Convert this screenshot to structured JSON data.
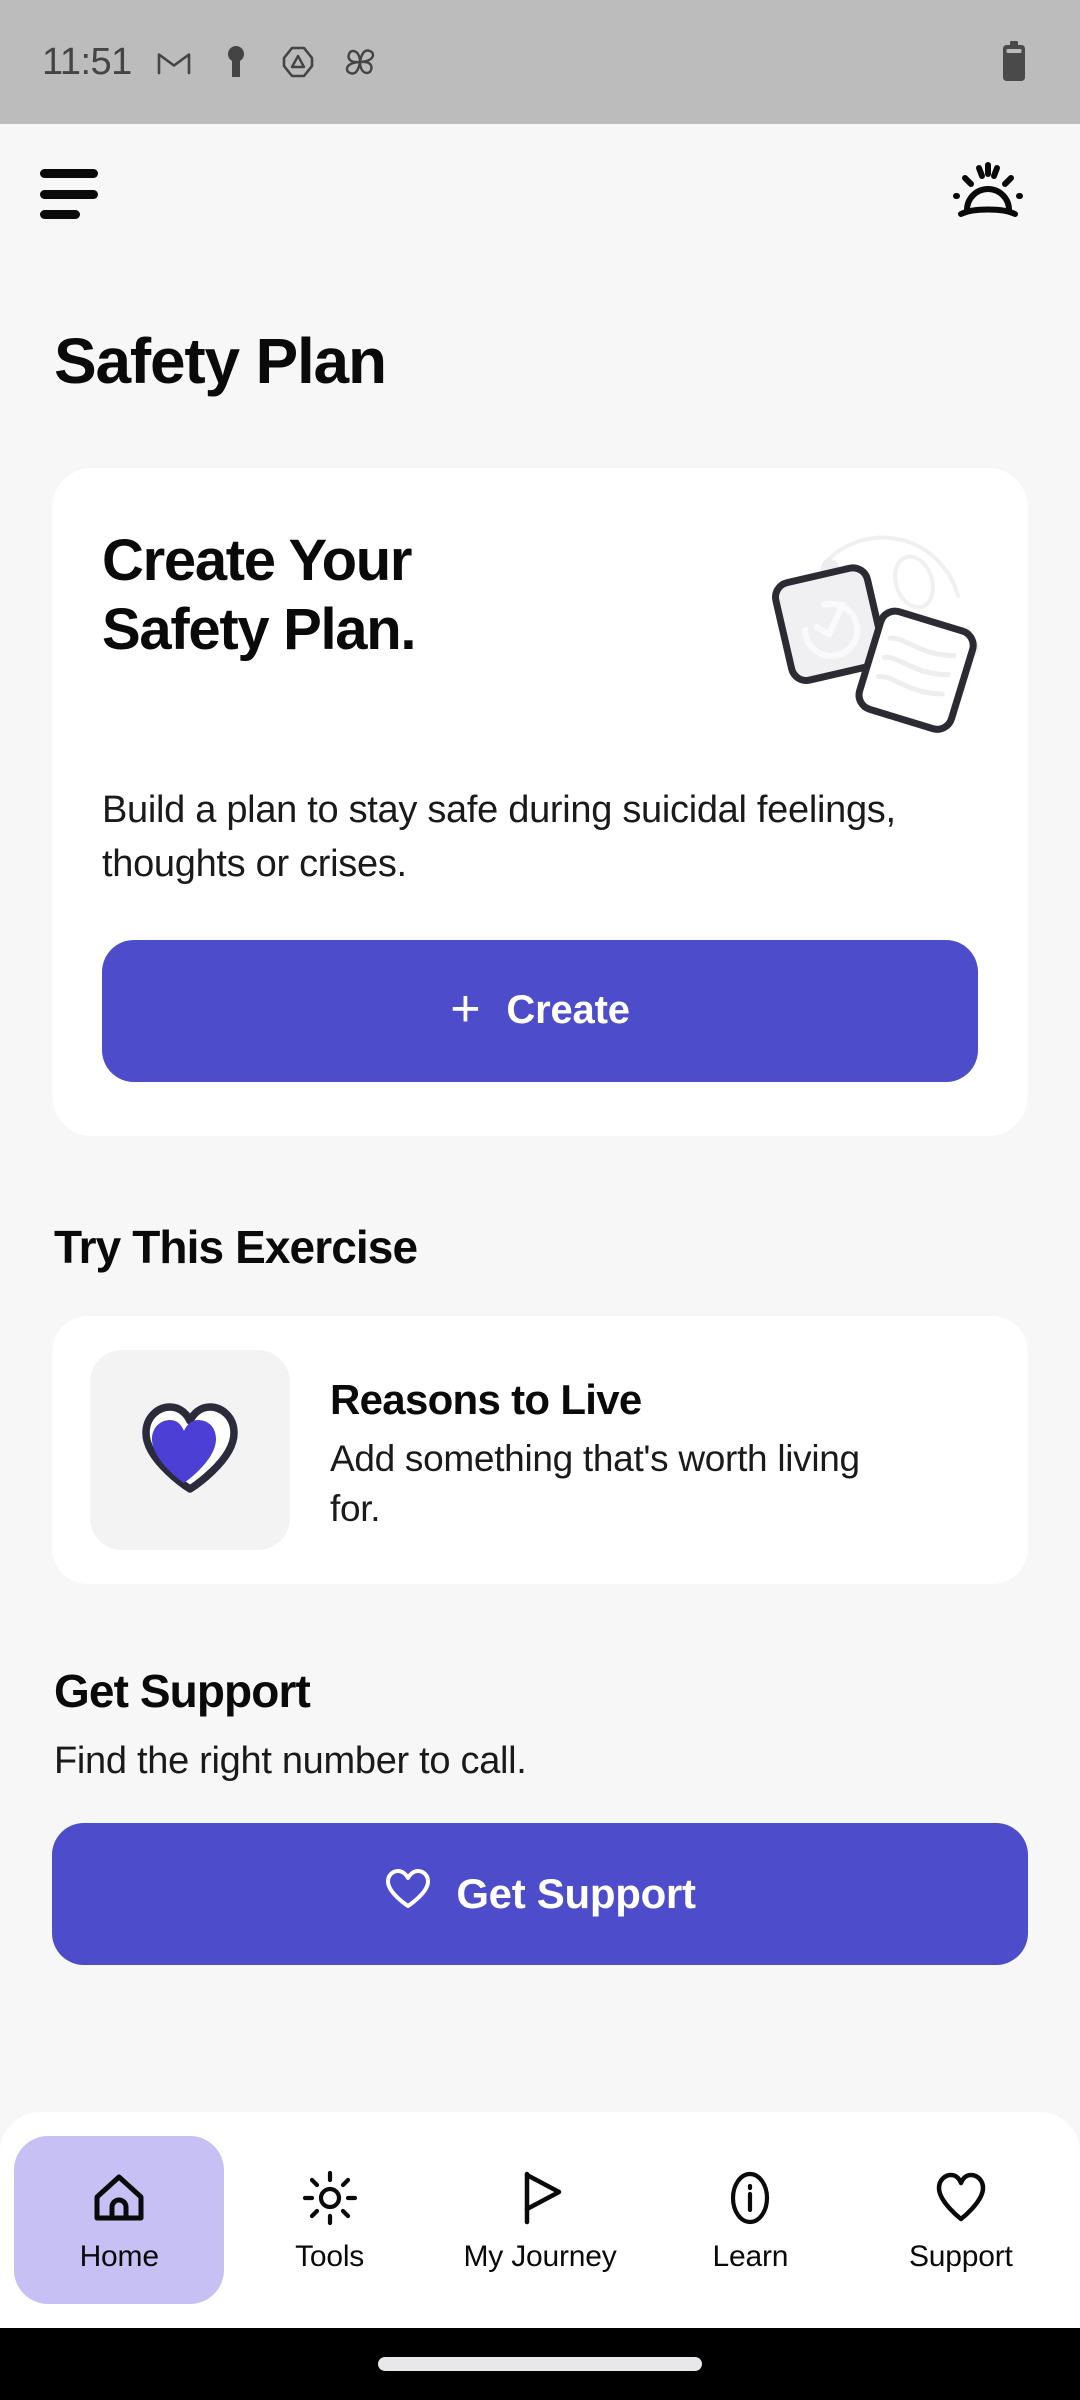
{
  "status_bar": {
    "time": "11:51",
    "icons": [
      "gmail-icon",
      "keyhole-icon",
      "drive-triangle-icon",
      "pinwheel-icon"
    ],
    "battery": "battery-icon"
  },
  "app_bar": {
    "menu": "hamburger-menu-icon",
    "theme_toggle": "sunrise-icon"
  },
  "page": {
    "title": "Safety Plan",
    "background_color": "#F7F7F7",
    "accent_color": "#4D4CCB",
    "active_nav_color": "#C6C0F5"
  },
  "hero_card": {
    "heading": "Create Your\nSafety Plan.",
    "body": "Build a plan to stay safe during suicidal feelings, thoughts or crises.",
    "button_label": "Create",
    "button_icon": "plus-icon",
    "illustration": "two-notes-checkmark-illustration"
  },
  "exercise_section": {
    "title": "Try This Exercise",
    "card": {
      "icon": "heart-icon",
      "title": "Reasons to Live",
      "description": "Add something that's worth living for."
    }
  },
  "support_section": {
    "title": "Get Support",
    "subtitle": "Find the right number to call.",
    "button_label": "Get Support",
    "button_icon": "heart-outline-icon"
  },
  "bottom_nav": {
    "items": [
      {
        "label": "Home",
        "icon": "home-icon",
        "active": true
      },
      {
        "label": "Tools",
        "icon": "sun-icon",
        "active": false
      },
      {
        "label": "My Journey",
        "icon": "play-flag-icon",
        "active": false
      },
      {
        "label": "Learn",
        "icon": "info-circle-icon",
        "active": false
      },
      {
        "label": "Support",
        "icon": "heart-outline-icon",
        "active": false
      }
    ]
  }
}
